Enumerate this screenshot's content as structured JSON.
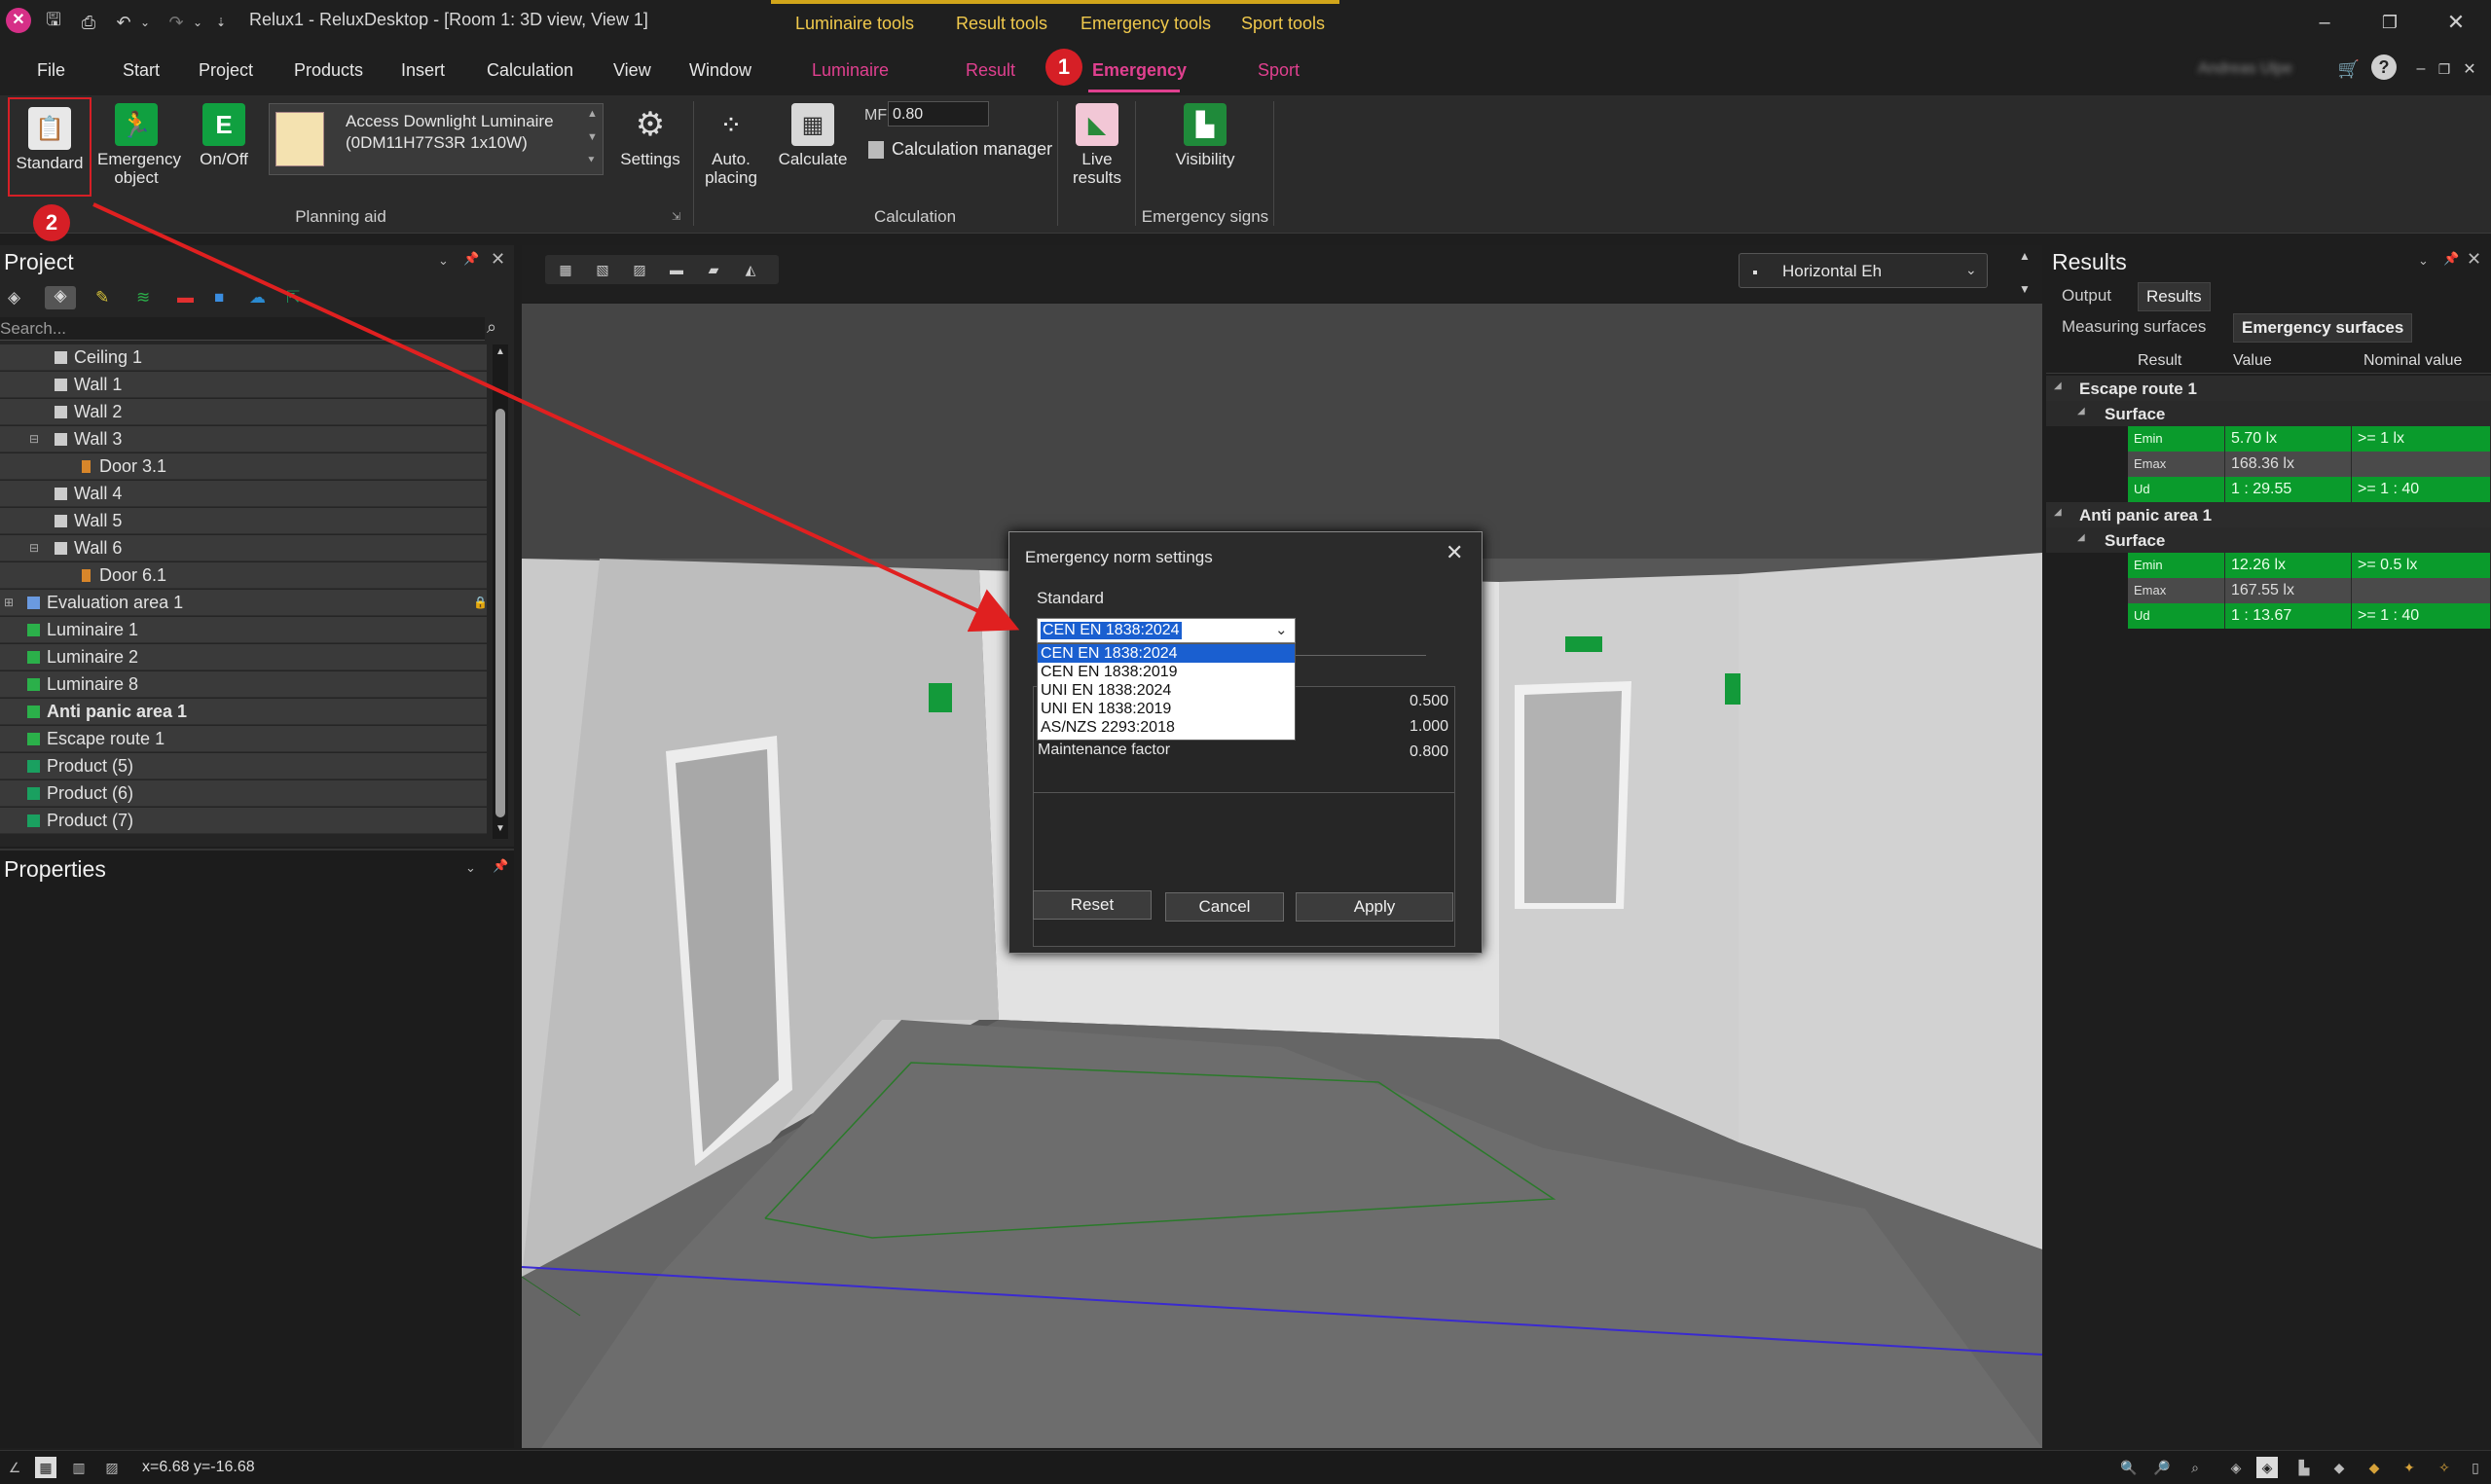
{
  "title_bar": {
    "title": "Relux1 - ReluxDesktop - [Room 1: 3D view, View 1]",
    "user_name": "Andreas Ulpe"
  },
  "context_tabs": [
    "Luminaire tools",
    "Result tools",
    "Emergency tools",
    "Sport tools"
  ],
  "menu": {
    "items": [
      "File",
      "Start",
      "Project",
      "Products",
      "Insert",
      "Calculation",
      "View",
      "Window"
    ],
    "context_items": [
      "Luminaire",
      "Result",
      "Emergency",
      "Sport"
    ],
    "active": "Emergency"
  },
  "ribbon": {
    "standard": "Standard",
    "emergency_object": "Emergency object",
    "onoff": "On/Off",
    "luminaire_line1": "Access Downlight Luminaire",
    "luminaire_line2": "(0DM11H77S3R 1x10W)",
    "settings": "Settings",
    "planning_aid": "Planning aid",
    "auto_placing": "Auto. placing",
    "calculate": "Calculate",
    "mf_label": "MF",
    "mf_value": "0.80",
    "calc_manager": "Calculation manager",
    "calculation_group": "Calculation",
    "live_results": "Live results",
    "visibility": "Visibility",
    "emergency_signs": "Emergency signs"
  },
  "badges": [
    "1",
    "2"
  ],
  "project": {
    "title": "Project",
    "search_placeholder": "Search...",
    "tree": [
      "Ceiling 1",
      "Wall 1",
      "Wall 2",
      "Wall 3",
      "Door 3.1",
      "Wall 4",
      "Wall 5",
      "Wall 6",
      "Door 6.1",
      "Evaluation area 1",
      "Luminaire  1",
      "Luminaire  2",
      "Luminaire  8",
      "Anti panic area 1",
      "Escape route 1",
      "Product (5)",
      "Product (6)",
      "Product (7)"
    ]
  },
  "properties": {
    "title": "Properties"
  },
  "viewport": {
    "view_select": "Horizontal Eh"
  },
  "dialog": {
    "title": "Emergency norm settings",
    "standard_label": "Standard",
    "selected": "CEN EN 1838:2024",
    "options": [
      "CEN EN 1838:2024",
      "CEN EN 1838:2019",
      "UNI EN 1838:2024",
      "UNI EN 1838:2019",
      "AS/NZS 2293:2018"
    ],
    "values": [
      "0.500",
      "1.000"
    ],
    "maintenance_label": "Maintenance factor",
    "maintenance_value": "0.800",
    "reset": "Reset",
    "cancel": "Cancel",
    "apply": "Apply"
  },
  "results": {
    "title": "Results",
    "tabs": [
      "Output",
      "Results"
    ],
    "subtabs": [
      "Measuring surfaces",
      "Emergency surfaces"
    ],
    "headers": [
      "Result",
      "Value",
      "Nominal value"
    ],
    "groups": [
      {
        "name": "Escape route 1",
        "surface": "Surface",
        "rows": [
          {
            "k": "Emin",
            "v": "5.70 lx",
            "n": ">= 1 lx"
          },
          {
            "k": "Emax",
            "v": "168.36 lx",
            "n": ""
          },
          {
            "k": "Ud",
            "v": "1 : 29.55",
            "n": ">= 1 : 40"
          }
        ]
      },
      {
        "name": "Anti panic area 1",
        "surface": "Surface",
        "rows": [
          {
            "k": "Emin",
            "v": "12.26 lx",
            "n": ">= 0.5 lx"
          },
          {
            "k": "Emax",
            "v": "167.55 lx",
            "n": ""
          },
          {
            "k": "Ud",
            "v": "1 : 13.67",
            "n": ">= 1 : 40"
          }
        ]
      }
    ]
  },
  "status": {
    "coords": "x=6.68 y=-16.68"
  },
  "colors": {
    "accent": "#e0408f",
    "context": "#f0c94c",
    "green": "#0a9b2c",
    "badge": "#d61f26",
    "arrow": "#e02020"
  }
}
